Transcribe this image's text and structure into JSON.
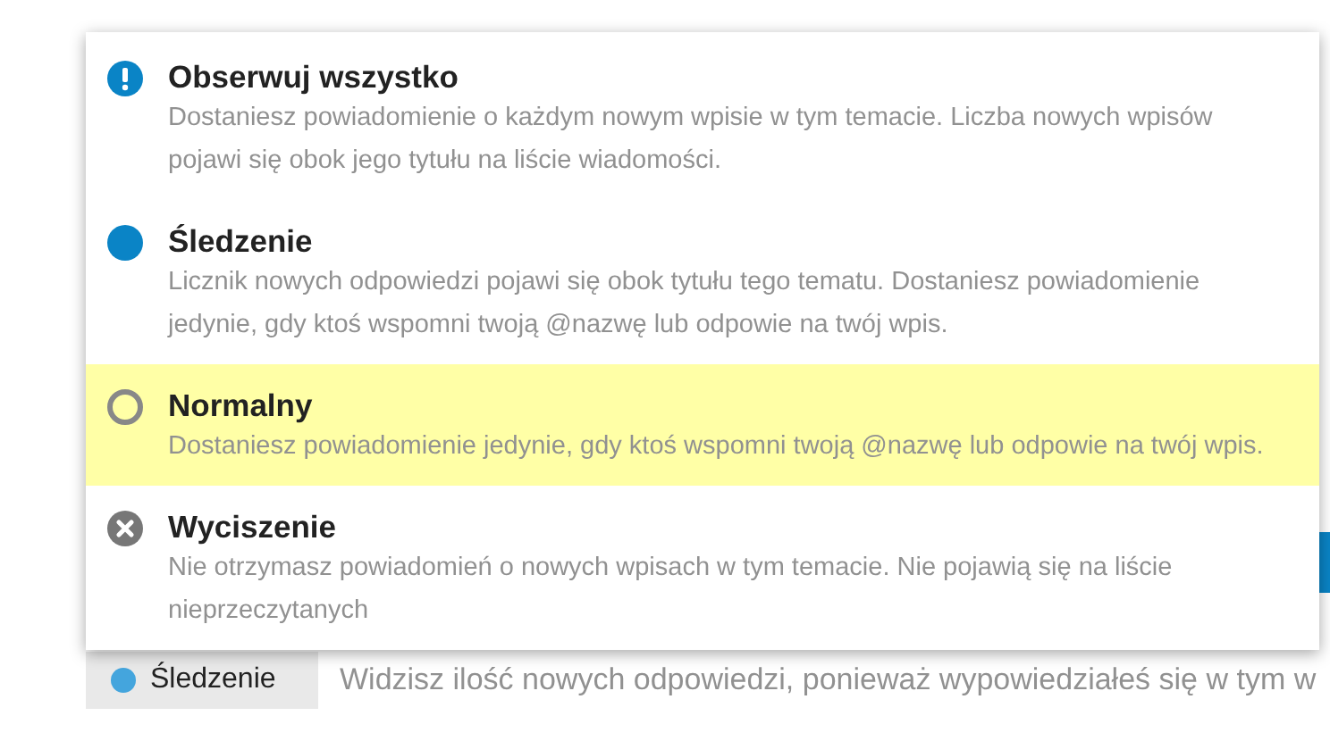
{
  "menu": {
    "items": [
      {
        "kind": "watch",
        "title": "Obserwuj wszystko",
        "description": "Dostaniesz powiadomienie o każdym nowym wpisie w tym temacie. Liczba nowych wpisów pojawi się obok jego tytułu na liście wiadomości.",
        "highlighted": false
      },
      {
        "kind": "track",
        "title": "Śledzenie",
        "description": "Licznik nowych odpowiedzi pojawi się obok tytułu tego tematu. Dostaniesz powiadomienie jedynie, gdy ktoś wspomni twoją @nazwę lub odpowie na twój wpis.",
        "highlighted": false
      },
      {
        "kind": "normal",
        "title": "Normalny",
        "description": "Dostaniesz powiadomienie jedynie, gdy ktoś wspomni twoją @nazwę lub odpowie na twój wpis.",
        "highlighted": true
      },
      {
        "kind": "mute",
        "title": "Wyciszenie",
        "description": "Nie otrzymasz powiadomień o nowych wpisach w tym temacie. Nie pojawią się na liście nieprzeczytanych",
        "highlighted": false
      }
    ]
  },
  "notification_bar": {
    "button_label": "Śledzenie",
    "description": "Widzisz ilość nowych odpowiedzi, ponieważ wypowiedziałeś się w tym w"
  }
}
